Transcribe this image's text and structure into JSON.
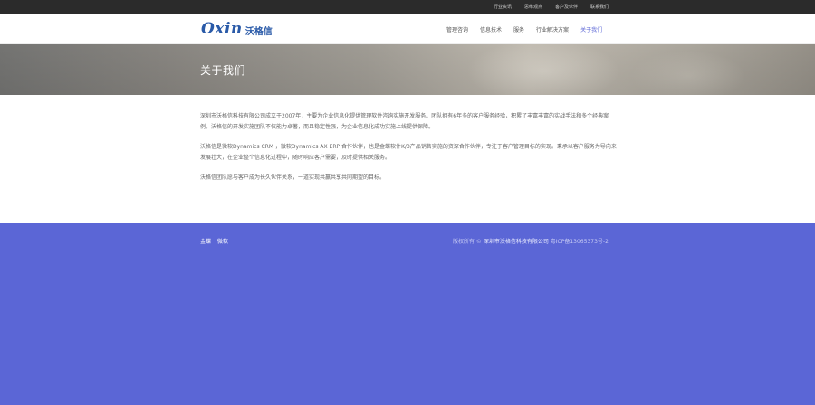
{
  "topbar": {
    "links": [
      "行业资讯",
      "思维观点",
      "客户及伙伴",
      "联系我们"
    ]
  },
  "header": {
    "logo_latin": "Oxin",
    "logo_cn": "沃格信",
    "nav": [
      "管理咨询",
      "信息技术",
      "服务",
      "行业解决方案",
      "关于我们"
    ],
    "active_nav": "关于我们",
    "accent_color": "#5b66d6"
  },
  "banner": {
    "title": "关于我们"
  },
  "content": {
    "paragraphs": [
      "深圳市沃格信科技有限公司成立于2007年，主要为企业信息化提供管理软件咨询实施开发服务。团队拥有6年多的客户服务经验，积累了丰富丰富的实战手法和多个经典案例。沃格信的开发实施团队不仅能力卓著，而且稳定性强，为企业信息化成功实施上线提供保障。",
      "沃格信是微软Dynamics CRM ，微软Dynamics AX ERP 合作伙伴，也是金蝶软件K/3产品销售实施的资深合作伙伴，专注于客户管理目标的实现。秉承以客户服务为导向来发展壮大，在企业整个信息化过程中，随时响应客户需要，及时提供相关服务。",
      "沃格信团队愿与客户成为长久伙伴关系，一道实现共赢共享共同期望的目标。"
    ]
  },
  "footer": {
    "links": [
      "金蝶",
      "微软"
    ],
    "copyright_prefix": "版权所有 ©",
    "company": "深圳市沃格信科技有限公司",
    "icp": "粤ICP备13065373号-2"
  }
}
